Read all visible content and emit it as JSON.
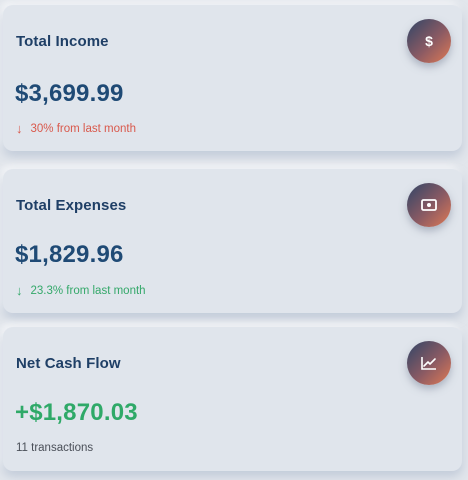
{
  "cards": [
    {
      "title": "Total Income",
      "amount": "$3,699.99",
      "trend_arrow": "↓",
      "subtitle": "30% from last month",
      "icon": "dollar-icon"
    },
    {
      "title": "Total Expenses",
      "amount": "$1,829.96",
      "trend_arrow": "↓",
      "subtitle": "23.3% from last month",
      "icon": "money-bill-icon"
    },
    {
      "title": "Net Cash Flow",
      "amount": "+$1,870.03",
      "subtitle": "11 transactions",
      "icon": "chart-line-icon"
    }
  ],
  "colors": {
    "title": "#1f3f66",
    "amount": "#1f4a75",
    "positive": "#2fa968",
    "negative": "#d9594c",
    "badge_start": "#2f4567",
    "badge_end": "#e07a55"
  }
}
